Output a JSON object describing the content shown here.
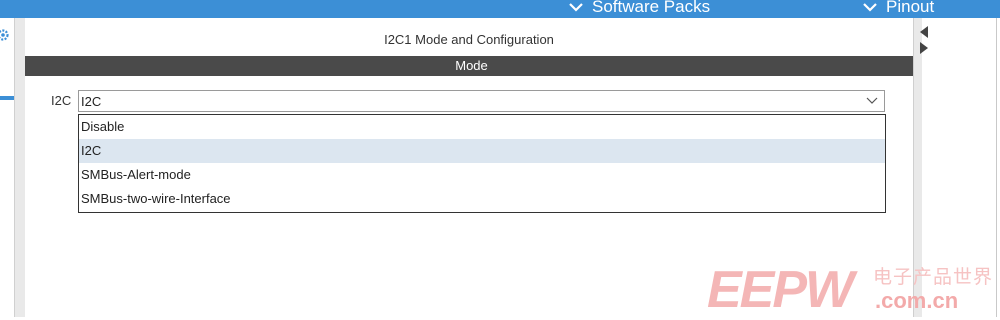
{
  "topbar": {
    "software_packs_label": "Software Packs",
    "pinout_label": "Pinout",
    "color": "#3c8fd6"
  },
  "panel": {
    "title": "I2C1 Mode and Configuration",
    "mode_header": "Mode"
  },
  "mode": {
    "field_label": "I2C",
    "selected_value": "I2C",
    "options": [
      "Disable",
      "I2C",
      "SMBus-Alert-mode",
      "SMBus-two-wire-Interface"
    ],
    "selected_index": 1
  },
  "watermark": {
    "logo": "EEPW",
    "chinese": "电子产品世界",
    "domain": ".com.cn"
  }
}
